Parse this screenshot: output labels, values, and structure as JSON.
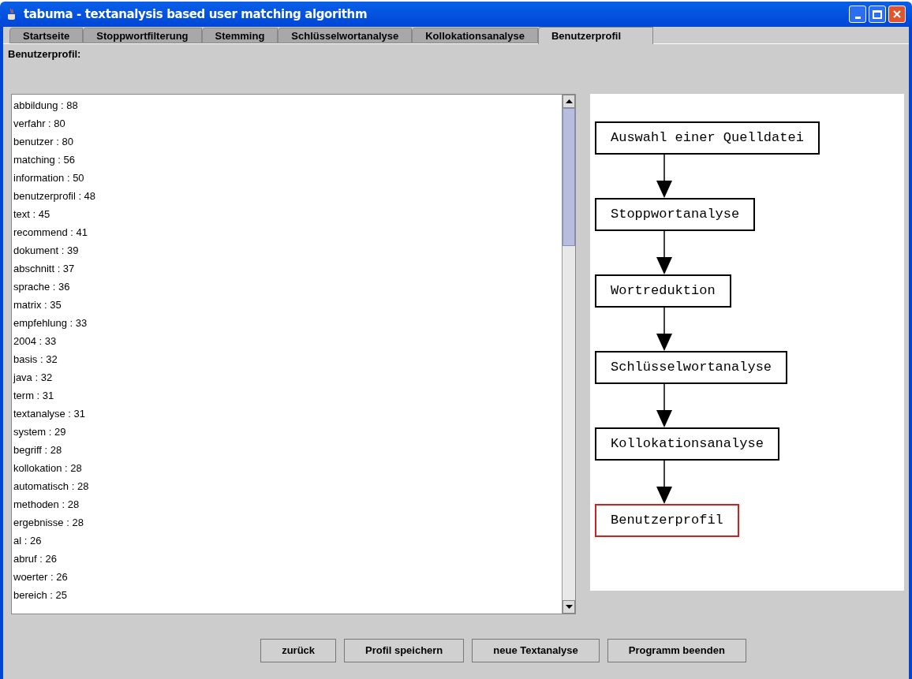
{
  "window": {
    "title": "tabuma - textanalysis based user matching algorithm"
  },
  "tabs": [
    {
      "label": "Startseite",
      "selected": false
    },
    {
      "label": "Stoppwortfilterung",
      "selected": false
    },
    {
      "label": "Stemming",
      "selected": false
    },
    {
      "label": "Schlüsselwortanalyse",
      "selected": false
    },
    {
      "label": "Kollokationsanalyse",
      "selected": false
    },
    {
      "label": "Benutzerprofil",
      "selected": true
    }
  ],
  "heading": "Benutzerprofil:",
  "profile_list": [
    "abbildung : 88",
    "verfahr : 80",
    "benutzer : 80",
    "matching : 56",
    "information : 50",
    "benutzerprofil : 48",
    "text : 45",
    "recommend : 41",
    "dokument : 39",
    "abschnitt : 37",
    "sprache : 36",
    "matrix : 35",
    "empfehlung : 33",
    "2004 : 33",
    "basis : 32",
    "java : 32",
    "term : 31",
    "textanalyse : 31",
    "system : 29",
    "begriff : 28",
    "kollokation : 28",
    "automatisch : 28",
    "methoden : 28",
    "ergebnisse : 28",
    "al : 26",
    "abruf : 26",
    "woerter : 26",
    "bereich : 25"
  ],
  "flow_steps": [
    {
      "label": "Auswahl einer Quelldatei",
      "current": false
    },
    {
      "label": "Stoppwortanalyse",
      "current": false
    },
    {
      "label": "Wortreduktion",
      "current": false
    },
    {
      "label": "Schlüsselwortanalyse",
      "current": false
    },
    {
      "label": "Kollokationsanalyse",
      "current": false
    },
    {
      "label": "Benutzerprofil",
      "current": true
    }
  ],
  "buttons": [
    "zurück",
    "Profil speichern",
    "neue Textanalyse",
    "Programm beenden"
  ]
}
